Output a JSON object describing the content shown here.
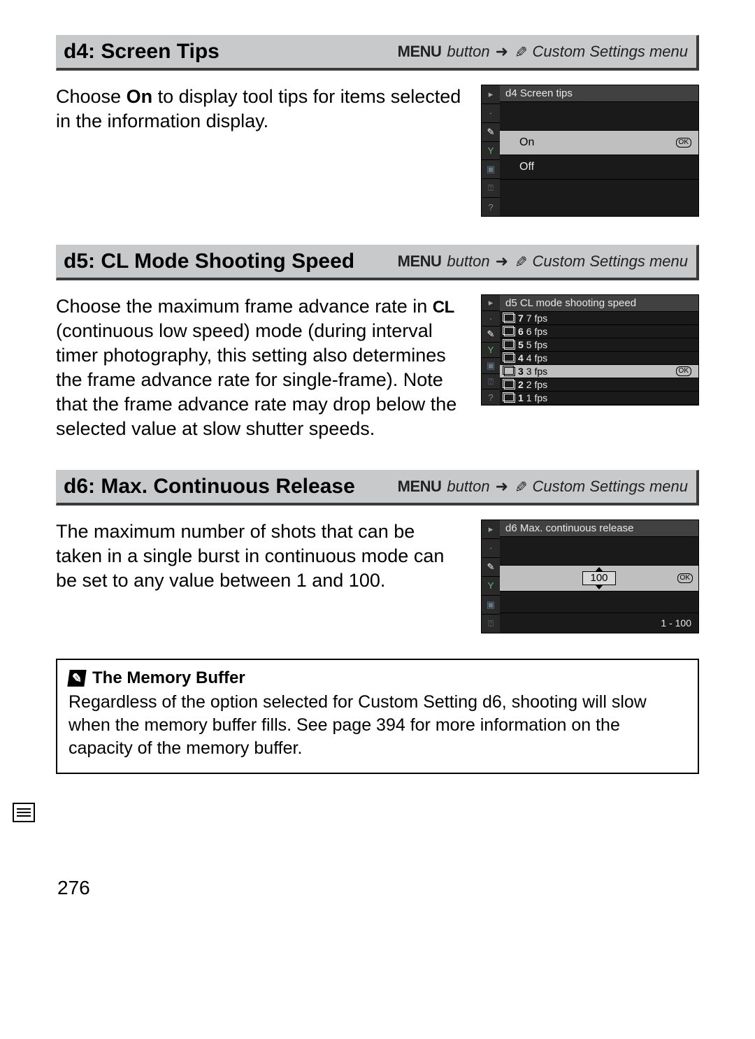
{
  "nav": {
    "menu_word": "MENU",
    "button_word": "button",
    "arrow": "➜",
    "menu_name": "Custom Settings menu"
  },
  "d4": {
    "title": "d4: Screen Tips",
    "body_pre": "Choose ",
    "body_bold": "On",
    "body_post": " to display tool tips for items selected in the information display.",
    "lcd_title": "d4 Screen tips",
    "opt_on": "On",
    "opt_off": "Off",
    "ok": "OK"
  },
  "d5": {
    "title": "d5: CL Mode Shooting Speed",
    "body_pre": "Choose the maximum frame advance rate in ",
    "body_sc": "CL",
    "body_post": " (continuous low speed) mode (during interval timer photography, this setting also determines the frame advance rate for single-frame).  Note that the frame advance rate may drop below the selected value at slow shutter speeds.",
    "lcd_title": "d5 CL mode shooting speed",
    "options": [
      {
        "num": "7",
        "txt": "7 fps"
      },
      {
        "num": "6",
        "txt": "6 fps"
      },
      {
        "num": "5",
        "txt": "5 fps"
      },
      {
        "num": "4",
        "txt": "4 fps"
      },
      {
        "num": "3",
        "txt": "3 fps"
      },
      {
        "num": "2",
        "txt": "2 fps"
      },
      {
        "num": "1",
        "txt": "1 fps"
      }
    ],
    "selected_index": 4,
    "ok": "OK"
  },
  "d6": {
    "title": "d6: Max.  Continuous Release",
    "body": "The maximum number of shots that can be taken in a single burst in continuous mode can be set to any value between 1 and 100.",
    "lcd_title": "d6 Max. continuous release",
    "value": "100",
    "range": "1 - 100",
    "ok": "OK"
  },
  "note": {
    "title": "The Memory Buffer",
    "body": "Regardless of the option selected for Custom Setting d6, shooting will slow when the memory buffer fills.  See page 394 for more information on the capacity of the memory buffer."
  },
  "page_number": "276"
}
